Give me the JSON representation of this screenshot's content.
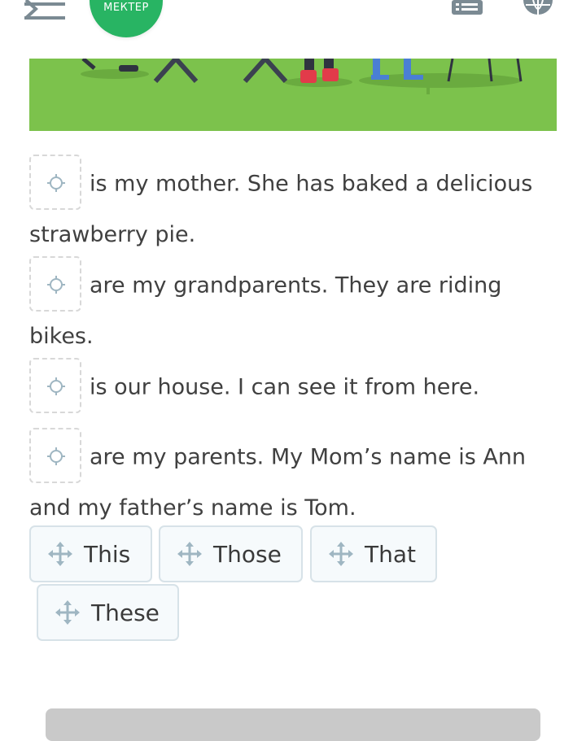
{
  "header": {
    "logo_text": "МЕКТЕР",
    "icons": [
      "menu-icon",
      "list-icon",
      "globe-icon"
    ],
    "logo_color": "#28b463"
  },
  "banner": {
    "color": "#7cc24c"
  },
  "sentences": [
    {
      "text": "is my mother. She has baked a delicious strawberry pie.",
      "answer": ""
    },
    {
      "text": "are my grandparents. They are riding bikes.",
      "answer": ""
    },
    {
      "text": "is our house. I can see it from here.",
      "answer": ""
    },
    {
      "text": "are my parents. My Mom’s name is Ann and my father’s name is Tom.",
      "answer": ""
    }
  ],
  "options": [
    {
      "label": "This",
      "icon": "move-icon"
    },
    {
      "label": "Those",
      "icon": "move-icon"
    },
    {
      "label": "That",
      "icon": "move-icon"
    },
    {
      "label": "These",
      "icon": "move-icon"
    }
  ]
}
